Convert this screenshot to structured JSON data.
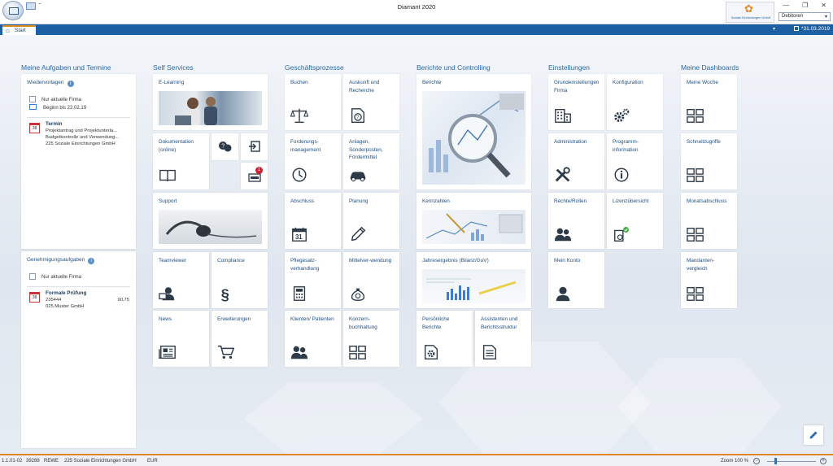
{
  "window": {
    "title": "Diamant 2020",
    "logo_text": "Soziale Einrichtungen GmbH",
    "context_select": "Debitoren",
    "controls": [
      "—",
      "❐",
      "✕"
    ]
  },
  "tabbar": {
    "tab_start": "Start",
    "date": "*31.03.2019"
  },
  "sections": {
    "tasks": "Meine Aufgaben und Termine",
    "self_services": "Self Services",
    "business": "Geschäftsprozesse",
    "reports": "Berichte und Controlling",
    "settings": "Einstellungen",
    "dashboards": "Meine Dashboards"
  },
  "wiedervorlagen": {
    "title": "Wiedervorlagen",
    "info": "i",
    "filter_current_company": "Nur aktuelle Firma",
    "starting": "Beginn bis 22.02.19",
    "entry": {
      "cal": "38",
      "title": "Termin",
      "line1": "Projektantrag und Projektunterla...",
      "line2": "Budgetkontrolle und Verwendung...",
      "line3": "225 Soziale Einrichtungen GmbH"
    }
  },
  "genehmigung": {
    "title": "Genehmigungsaufgaben",
    "info": "i",
    "filter_current_company": "Nur aktuelle Firma",
    "entry": {
      "cal": "38",
      "title": "Formale Prüfung",
      "number": "235444",
      "amount": "90,75",
      "company": "025 Muster GmbH"
    }
  },
  "self_services": {
    "elearning": "E-Learning",
    "dokumentation": "Dokumentation (online)",
    "support": "Support",
    "teamviewer": "Teamviewer",
    "compliance": "Compliance",
    "news": "News",
    "erweiterungen": "Erweiterungen",
    "badge": "1"
  },
  "business": {
    "buchen": "Buchen",
    "auskunft": "Auskunft und Recherche",
    "forderung": "Forderungs-management",
    "anlagen": "Anlagen, Sonderposten, Fördermittel",
    "abschluss": "Abschluss",
    "planung": "Planung",
    "pflegesatz": "Pflegesatz-verhandlung",
    "mittelverwendung": "Mittelver-wendung",
    "klienten": "Klienten/ Patienten",
    "konzern": "Konzern-buchhaltung",
    "cal_day": "31"
  },
  "reports": {
    "berichte": "Berichte",
    "kennzahlen": "Kennzahlen",
    "jahresergebnis": "Jahresergebnis (Bilanz/GuV)",
    "persoenliche": "Persönliche Berichte",
    "assistenten": "Assistenten und Berichtsstruktur"
  },
  "settings": {
    "grundeinstellungen": "Grundeinstellungen Firma",
    "konfiguration": "Konfiguration",
    "administration": "Administration",
    "programminfo": "Programm-information",
    "rechte": "Rechte/Rollen",
    "lizenz": "Lizenzübersicht",
    "konto": "Mein Konto"
  },
  "dashboards": {
    "woche": "Meine Woche",
    "schnell": "Schnellzugriffe",
    "monat": "Monatsabschluss",
    "mandanten": "Mandanten-vergleich"
  },
  "statusbar": {
    "version": "1.1.01-02",
    "id": "39288",
    "user": "REWE",
    "company": "225 Soziale Einrichtungen GmbH",
    "currency": "EUR",
    "zoom": "Zoom 100 %",
    "zoom_minus": "−",
    "zoom_plus": "+"
  },
  "colors": {
    "accent": "#1d5fa3",
    "orange": "#e0891d",
    "heading": "#2b6aa8",
    "icon": "#2d3a48"
  }
}
